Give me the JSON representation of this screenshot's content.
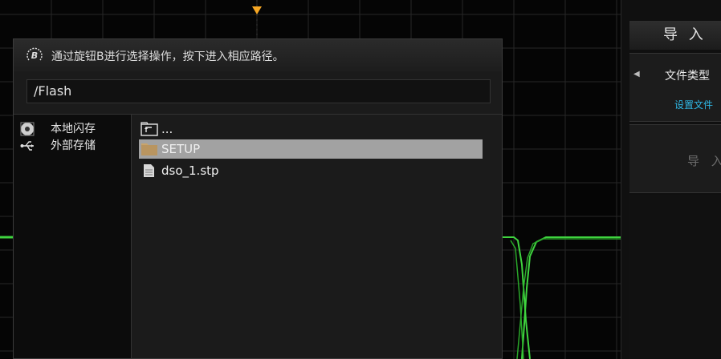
{
  "dialog": {
    "hint": "通过旋钮B进行选择操作，按下进入相应路径。",
    "knob_letter": "B",
    "path": "/Flash",
    "sidebar": [
      {
        "icon": "disk-icon",
        "label": "本地闪存"
      },
      {
        "icon": "usb-icon",
        "label": "外部存储"
      }
    ],
    "files": [
      {
        "icon": "parent-folder-icon",
        "label": "...",
        "selected": false
      },
      {
        "icon": "folder-icon",
        "label": "SETUP",
        "selected": true
      },
      {
        "icon": "file-icon",
        "label": "dso_1.stp",
        "selected": false
      }
    ]
  },
  "menu": {
    "title": "导 入",
    "item1_label": "文件类型",
    "item1_sub": "设置文件",
    "item2_label": "导 入"
  },
  "colors": {
    "trace": "#3fd43f",
    "trigger_marker": "#f5a623",
    "accent_blue": "#2fb7e4",
    "selection": "#a2a2a2"
  }
}
